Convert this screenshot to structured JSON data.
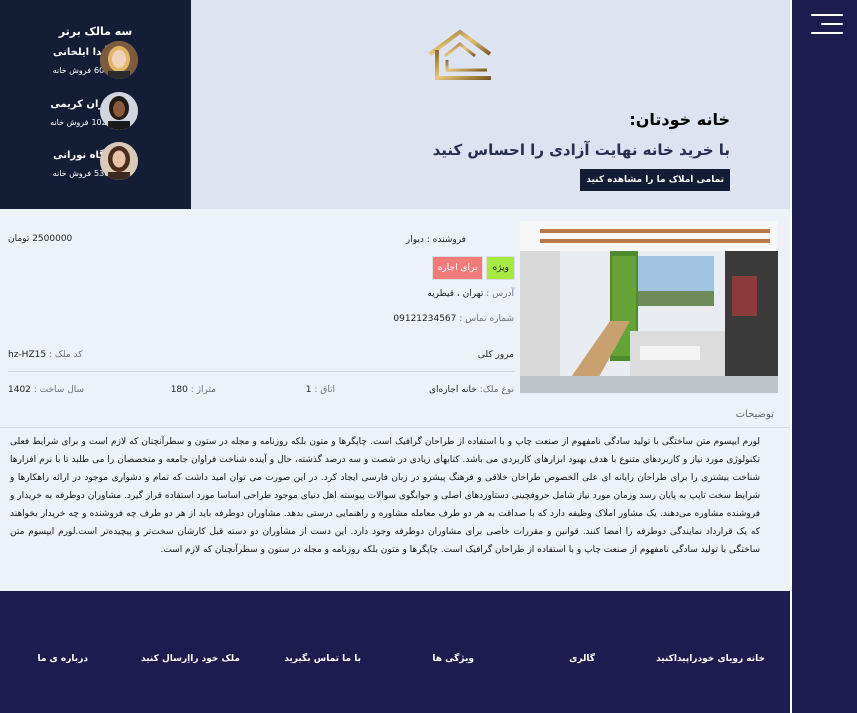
{
  "top_owners": {
    "title": "سه مالک برتر",
    "sold_suffix": "فروش خانه",
    "owners": [
      {
        "name": "آیدا ایلخانی",
        "sold": "605"
      },
      {
        "name": "باران کریمی",
        "sold": "1024"
      },
      {
        "name": "پگاه نورانی",
        "sold": "530"
      }
    ]
  },
  "hero": {
    "brand": "خانه خودتان:",
    "tagline": "با خرید خانه نهایت آزادی را احساس کنید",
    "cta": "تمامی املاک ما را مشاهده کنید"
  },
  "listing": {
    "price": "2500000 تومان",
    "seller_label": "فروشنده : ",
    "seller": "دیوار",
    "badge_special": "ویژه",
    "badge_rent": "برای اجاره",
    "address_label": "آدرس : ",
    "address": "تهران ، قیطریه",
    "phone_label": "شماره تماس : ",
    "phone": "09121234567",
    "code_label": "کد ملک : ",
    "code": "hz-HZ15",
    "views_label": "مرور کلی",
    "type_label": "نوع ملک: ",
    "type": "خانه اجاره‌ای",
    "rooms_label": "اتاق : ",
    "rooms": "1",
    "area_label": "متراژ : ",
    "area": "180",
    "year_label": "سال ساخت : ",
    "year": "1402",
    "desc_title": "توضیحات",
    "description": "لورم ایپسوم متن ساختگی با تولید سادگی نامفهوم از صنعت چاپ و با استفاده از طراحان گرافیک است. چاپگرها و متون بلکه روزنامه و مجله در ستون و سطرآنچنان که لازم است و برای شرایط فعلی تکنولوژی مورد نیاز و کاربردهای متنوع با هدف بهبود ابزارهای کاربردی می باشد. کتابهای زیادی در شصت و سه درصد گذشته، حال و آینده شناخت فراوان جامعه و متخصصان را می طلبد تا با نرم افزارها شناخت بیشتری را برای طراحان رایانه ای علی الخصوص طراحان خلاقی و فرهنگ پیشرو در زبان فارسی ایجاد کرد. در این صورت می توان امید داشت که تمام و دشواری موجود در ارائه راهکارها و شرایط سخت تایپ به پایان رسد وزمان مورد نیاز شامل حروفچینی دستاوردهای اصلی و جوابگوی سوالات پیوسته اهل دنیای موجود طراحی اساسا مورد استفاده قرار گیرد. مشاوران دوطرفه به خریدار و فروشنده مشاوره می‌دهند. یک مشاور املاک وظیفه دارد که با صداقت به هر دو طرف معامله مشاوره و راهنمایی درستی بدهد. مشاوران دوطرفه باید از هر دو طرف چه فروشنده و چه خریدار بخواهند که یک قرارداد نمایندگی دوطرفه را امضا کنند. قوانین و مقررات خاصی برای مشاوران دوطرفه وجود دارد. این دست از مشاوران دو دسته قبل کارشان سخت‌تر و پیچیده‌تر است.لورم ایپسوم متن ساختگی با تولید سادگی نامفهوم از صنعت چاپ و با استفاده از طراحان گرافیک است. چاپگرها و متون بلکه روزنامه و مجله در ستون و سطرآنچنان که لازم است."
  },
  "footer": {
    "links": [
      "خانه رویای خودراپیداکنید",
      "گالری",
      "ویژگی ها",
      "با ما تماس بگیرید",
      "ملک خود رااِرسال کنید",
      "درباره ی ما"
    ]
  },
  "colors": {
    "navy": "#1e1b4f",
    "dark_panel": "#141d36",
    "special_badge": "#a7ea44",
    "rent_badge": "#ef7b7b"
  },
  "icons": [
    "hamburger-menu-icon",
    "house-logo-icon"
  ]
}
